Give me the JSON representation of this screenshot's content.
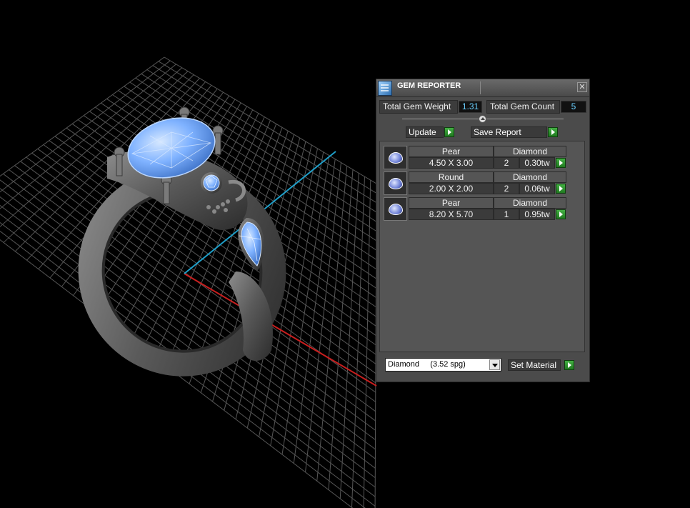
{
  "window": {
    "title": "GEM REPORTER",
    "close_glyph": "✕"
  },
  "stats": {
    "total_weight_label": "Total Gem Weight",
    "total_weight_value": "1.31",
    "total_count_label": "Total Gem Count",
    "total_count_value": "5"
  },
  "actions": {
    "update_label": "Update",
    "save_report_label": "Save Report"
  },
  "gems": [
    {
      "shape": "Pear",
      "size": "4.50 X 3.00",
      "count": "2",
      "material": "Diamond",
      "weight": "0.30tw",
      "icon": "pear-gem-icon"
    },
    {
      "shape": "Round",
      "size": "2.00 X 2.00",
      "count": "2",
      "material": "Diamond",
      "weight": "0.06tw",
      "icon": "round-gem-icon"
    },
    {
      "shape": "Pear",
      "size": "8.20 X 5.70",
      "count": "1",
      "material": "Diamond",
      "weight": "0.95tw",
      "icon": "pear-gem-icon"
    }
  ],
  "material": {
    "selected": "Diamond     (3.52 spg)",
    "set_material_label": "Set Material"
  },
  "colors": {
    "panel": "#4b4b4b",
    "value_text": "#6ad0ff",
    "go_button": "#2f9a2f",
    "gem_blue": "#6aa6ff",
    "grid_line": "#5a5a5a",
    "axis_red": "#c81e1e",
    "axis_cyan": "#1e9ec8"
  }
}
